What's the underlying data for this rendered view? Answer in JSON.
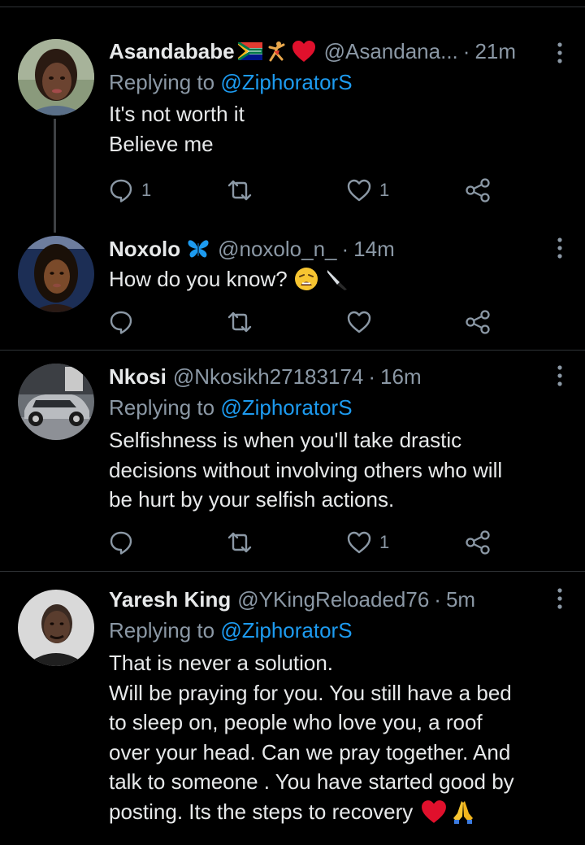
{
  "colors": {
    "background": "#000000",
    "text": "#e7e9ea",
    "secondary": "#8b98a5",
    "accent": "#1d9bf0",
    "divider": "#2f3336",
    "heart": "#e0245e"
  },
  "tweets": [
    {
      "name": "Asandababe",
      "badges": [
        "south-africa-flag-icon",
        "dancer-icon",
        "red-heart-icon"
      ],
      "handle": "@Asandana...",
      "separator": "·",
      "time": "21m",
      "replying_prefix": "Replying to",
      "replying_to": "@ZiphoratorS",
      "lines": [
        "It's not worth it",
        "Believe me"
      ],
      "replies": "1",
      "retweets": "",
      "likes": "1"
    },
    {
      "name": "Noxolo",
      "badges": [
        "butterfly-icon"
      ],
      "handle": "@noxolo_n_",
      "separator": "·",
      "time": "14m",
      "lines": [
        "How do you know?"
      ],
      "trailing_icons": [
        "weary-face-icon",
        "knife-icon"
      ],
      "replies": "",
      "retweets": "",
      "likes": ""
    },
    {
      "name": "Nkosi",
      "handle": "@Nkosikh27183174",
      "separator": "·",
      "time": "16m",
      "replying_prefix": "Replying to",
      "replying_to": "@ZiphoratorS",
      "lines": [
        "Selfishness is when you'll take drastic",
        "decisions without involving others who will",
        "be hurt by your selfish actions."
      ],
      "replies": "",
      "retweets": "",
      "likes": "1"
    },
    {
      "name": "Yaresh King",
      "handle": "@YKingReloaded76",
      "separator": "·",
      "time": "5m",
      "replying_prefix": "Replying to",
      "replying_to": "@ZiphoratorS",
      "lines": [
        "That is never a solution.",
        "Will be praying for you.  You still have a bed",
        "to sleep on, people who  love you, a roof",
        "over your head.  Can we pray  together. And",
        "talk to someone  . You have started  good by",
        "posting. Its the steps to recovery"
      ],
      "trailing_icons": [
        "red-heart-icon",
        "praying-hands-icon"
      ]
    }
  ]
}
